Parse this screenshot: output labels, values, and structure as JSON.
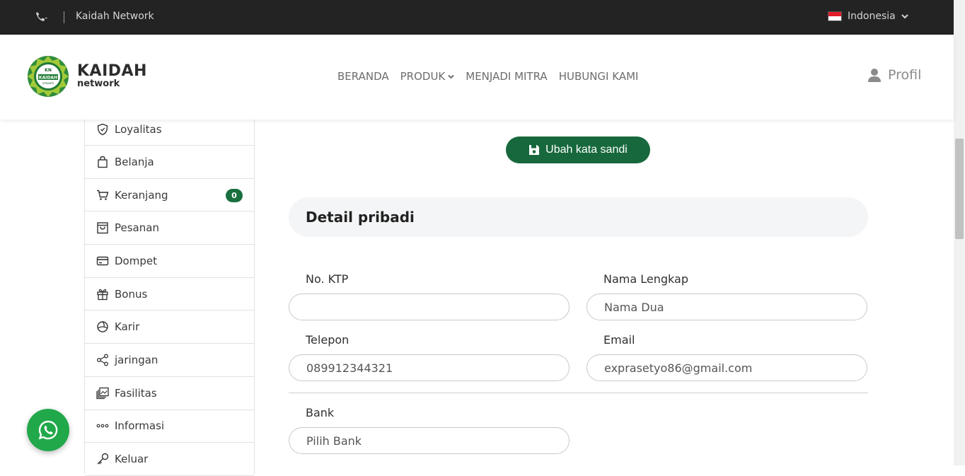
{
  "topbar": {
    "phone_text": "-",
    "brand": "Kaidah Network",
    "language": "Indonesia"
  },
  "header": {
    "logo_big": "KAIDAH",
    "logo_small": "network",
    "badge_top": "KN",
    "badge_mid": "KAIDAH",
    "badge_bottom": "network",
    "nav": [
      "BERANDA",
      "PRODUK",
      "MENJADI MITRA",
      "HUBUNGI KAMI"
    ],
    "profile": "Profil"
  },
  "sidebar": {
    "items": [
      {
        "label": "Loyalitas",
        "icon": "shield-icon"
      },
      {
        "label": "Belanja",
        "icon": "shopping-bag-icon"
      },
      {
        "label": "Keranjang",
        "icon": "cart-icon",
        "badge": "0"
      },
      {
        "label": "Pesanan",
        "icon": "order-bag-icon"
      },
      {
        "label": "Dompet",
        "icon": "wallet-icon"
      },
      {
        "label": "Bonus",
        "icon": "gift-icon"
      },
      {
        "label": "Karir",
        "icon": "career-icon"
      },
      {
        "label": "jaringan",
        "icon": "share-icon"
      },
      {
        "label": "Fasilitas",
        "icon": "images-icon"
      },
      {
        "label": "Informasi",
        "icon": "dots-icon"
      },
      {
        "label": "Keluar",
        "icon": "key-icon"
      }
    ]
  },
  "main": {
    "save_button": "Ubah kata sandi",
    "section_title": "Detail pribadi",
    "fields": {
      "ktp_label": "No. KTP",
      "ktp_value": "",
      "name_label": "Nama Lengkap",
      "name_value": "Nama Dua",
      "phone_label": "Telepon",
      "phone_value": "089912344321",
      "email_label": "Email",
      "email_value": "exprasetyo86@gmail.com",
      "bank_label": "Bank",
      "bank_value": "Pilih Bank"
    }
  },
  "colors": {
    "brand_green": "#17683c",
    "topbar": "#232323",
    "whatsapp": "#21a84a"
  }
}
